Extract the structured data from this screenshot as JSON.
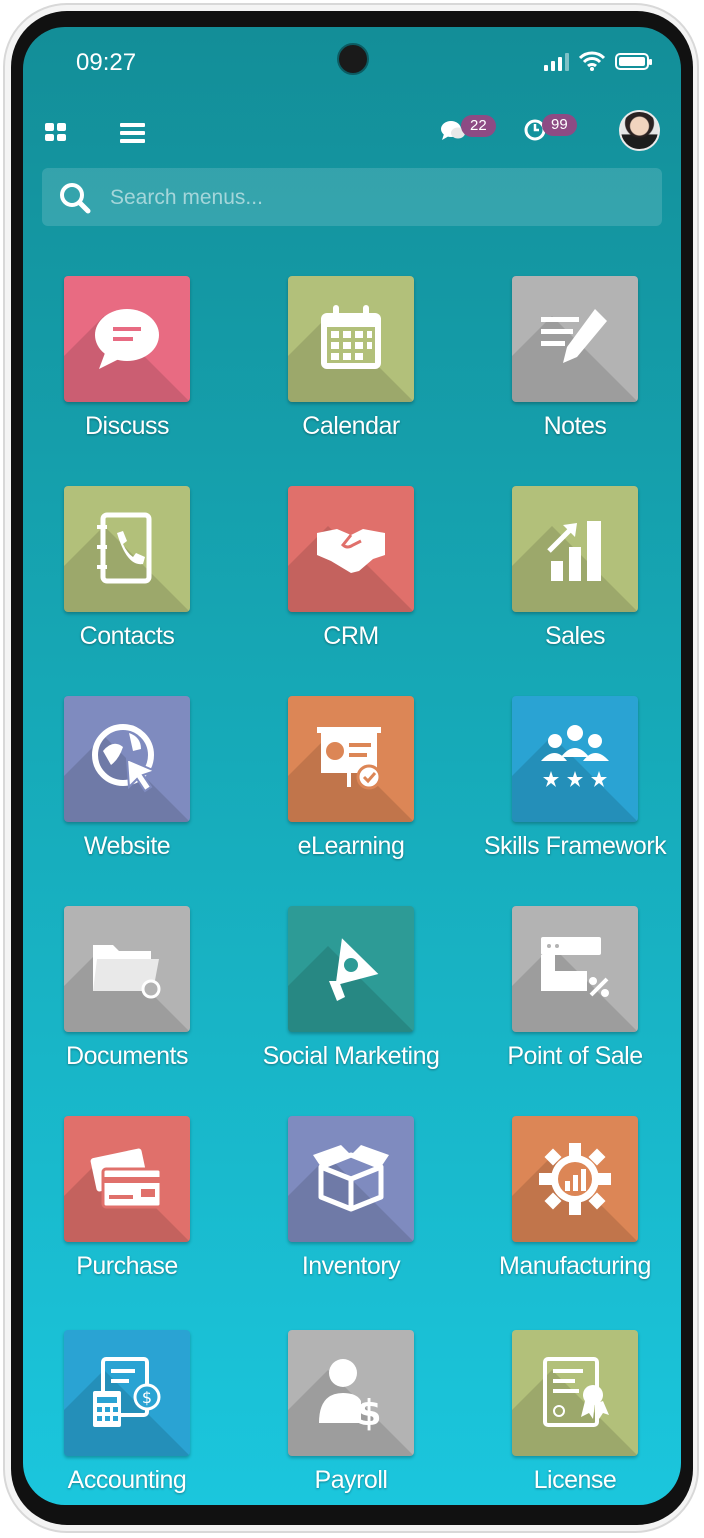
{
  "status_bar": {
    "time": "09:27"
  },
  "top_bar": {
    "messages_count": "22",
    "activities_count": "99"
  },
  "search": {
    "placeholder": "Search menus..."
  },
  "apps": [
    {
      "label": "Discuss",
      "color": "#e86b82",
      "icon": "chat-bubble-icon"
    },
    {
      "label": "Calendar",
      "color": "#b2c07a",
      "icon": "calendar-icon"
    },
    {
      "label": "Notes",
      "color": "#b3b3b3",
      "icon": "pencil-note-icon"
    },
    {
      "label": "Contacts",
      "color": "#b2c07a",
      "icon": "phone-book-icon"
    },
    {
      "label": "CRM",
      "color": "#e0706b",
      "icon": "handshake-icon"
    },
    {
      "label": "Sales",
      "color": "#b2c07a",
      "icon": "bar-chart-icon"
    },
    {
      "label": "Website",
      "color": "#7f8bbf",
      "icon": "globe-cursor-icon"
    },
    {
      "label": "eLearning",
      "color": "#dc8656",
      "icon": "presentation-board-icon"
    },
    {
      "label": "Skills Framework",
      "color": "#2aa3d3",
      "icon": "team-stars-icon"
    },
    {
      "label": "Documents",
      "color": "#b3b3b3",
      "icon": "folder-icon"
    },
    {
      "label": "Social Marketing",
      "color": "#2d9b96",
      "icon": "megaphone-icon"
    },
    {
      "label": "Point of Sale",
      "color": "#b3b3b3",
      "icon": "shop-icon"
    },
    {
      "label": "Purchase",
      "color": "#e0706b",
      "icon": "credit-card-icon"
    },
    {
      "label": "Inventory",
      "color": "#7f8bbf",
      "icon": "box-icon"
    },
    {
      "label": "Manufacturing",
      "color": "#dc8656",
      "icon": "gear-chart-icon"
    },
    {
      "label": "Accounting",
      "color": "#2aa3d3",
      "icon": "calculator-invoice-icon"
    },
    {
      "label": "Payroll",
      "color": "#b3b3b3",
      "icon": "person-dollar-icon"
    },
    {
      "label": "License",
      "color": "#b2c07a",
      "icon": "certificate-icon"
    }
  ]
}
